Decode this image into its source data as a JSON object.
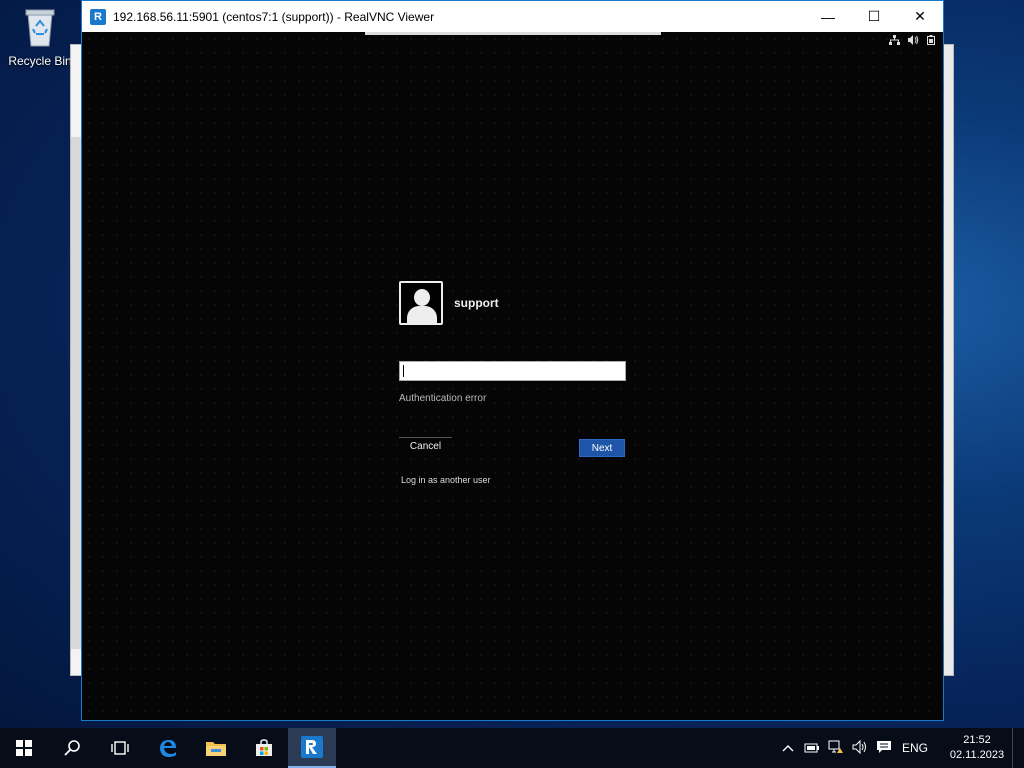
{
  "desktop": {
    "recycle_bin_label": "Recycle Bin"
  },
  "vnc_window": {
    "title": "192.168.56.11:5901 (centos7:1 (support)) - RealVNC Viewer",
    "app_icon_letter": "R",
    "controls": {
      "minimize": "—",
      "maximize": "☐",
      "close": "✕"
    }
  },
  "remote_login": {
    "username": "support",
    "password_value": "",
    "error_text": "Authentication error",
    "cancel_label": "Cancel",
    "next_label": "Next",
    "other_user_link": "Log in as another user"
  },
  "remote_status_icons": [
    "network-icon",
    "volume-icon",
    "battery-icon"
  ],
  "taskbar": {
    "items": [
      "start-icon",
      "search-icon",
      "task-view-icon",
      "edge-icon",
      "file-explorer-icon",
      "store-icon",
      "realvnc-icon"
    ],
    "tray": {
      "language": "ENG",
      "time": "21:52",
      "date": "02.11.2023"
    }
  },
  "colors": {
    "accent": "#1979ca",
    "next_button": "#1f55a8",
    "taskbar": "#070d18"
  }
}
